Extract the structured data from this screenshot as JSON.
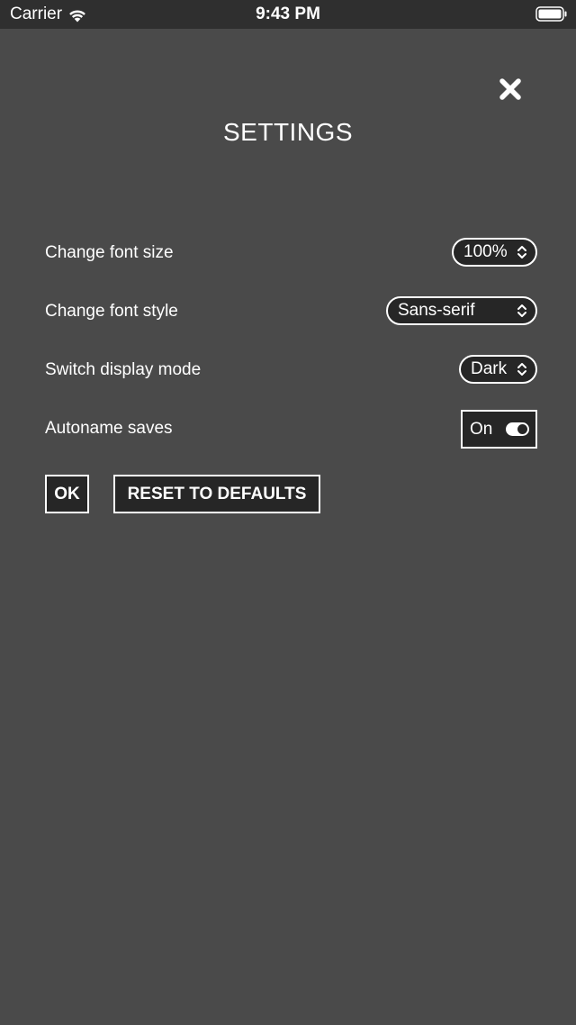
{
  "status_bar": {
    "carrier": "Carrier",
    "time": "9:43 PM",
    "icons": [
      "wifi-icon",
      "battery-icon"
    ]
  },
  "header": {
    "title": "SETTINGS",
    "close_icon": "close-icon"
  },
  "settings": {
    "font_size": {
      "label": "Change font size",
      "value": "100%"
    },
    "font_style": {
      "label": "Change font style",
      "value": "Sans-serif"
    },
    "display_mode": {
      "label": "Switch display mode",
      "value": "Dark"
    },
    "autoname": {
      "label": "Autoname saves",
      "value": "On",
      "enabled": true
    }
  },
  "actions": {
    "ok_label": "OK",
    "reset_label": "RESET TO DEFAULTS"
  },
  "colors": {
    "background": "#4a4a4a",
    "status_bar": "#2f2f2f",
    "control_background": "#262626",
    "foreground": "#ffffff"
  }
}
